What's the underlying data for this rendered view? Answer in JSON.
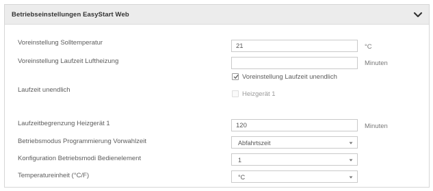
{
  "panel": {
    "title": "Betriebseinstellungen EasyStart Web",
    "toggle_icon": "chevron-down-icon"
  },
  "settings": {
    "soll_temperatur": {
      "label": "Voreinstellung Solltemperatur",
      "value": "21",
      "unit": "°C"
    },
    "laufzeit_luftheizung": {
      "label": "Voreinstellung Laufzeit Luftheizung",
      "value": "",
      "unit": "Minuten"
    },
    "laufzeit_unendlich": {
      "label": "Laufzeit unendlich",
      "option_preset_label": "Voreinstellung Laufzeit unendlich",
      "option_preset_checked": true,
      "option_heater_label": "Heizgerät 1",
      "option_heater_checked": false
    },
    "laufzeitbegrenzung": {
      "label": "Laufzeitbegrenzung Heizgerät 1",
      "value": "120",
      "unit": "Minuten"
    },
    "betriebsmodus": {
      "label": "Betriebsmodus Programmierung Vorwahlzeit",
      "selected": "Abfahrtszeit"
    },
    "konfiguration": {
      "label": "Konfiguration Betriebsmodi Bedienelement",
      "selected": "1"
    },
    "temperatureinheit": {
      "label": "Temperatureinheit (°C/F)",
      "selected": "°C"
    }
  },
  "colors": {
    "header_bg": "#ececec",
    "border": "#c9c9c9",
    "text": "#5c5c5c"
  }
}
